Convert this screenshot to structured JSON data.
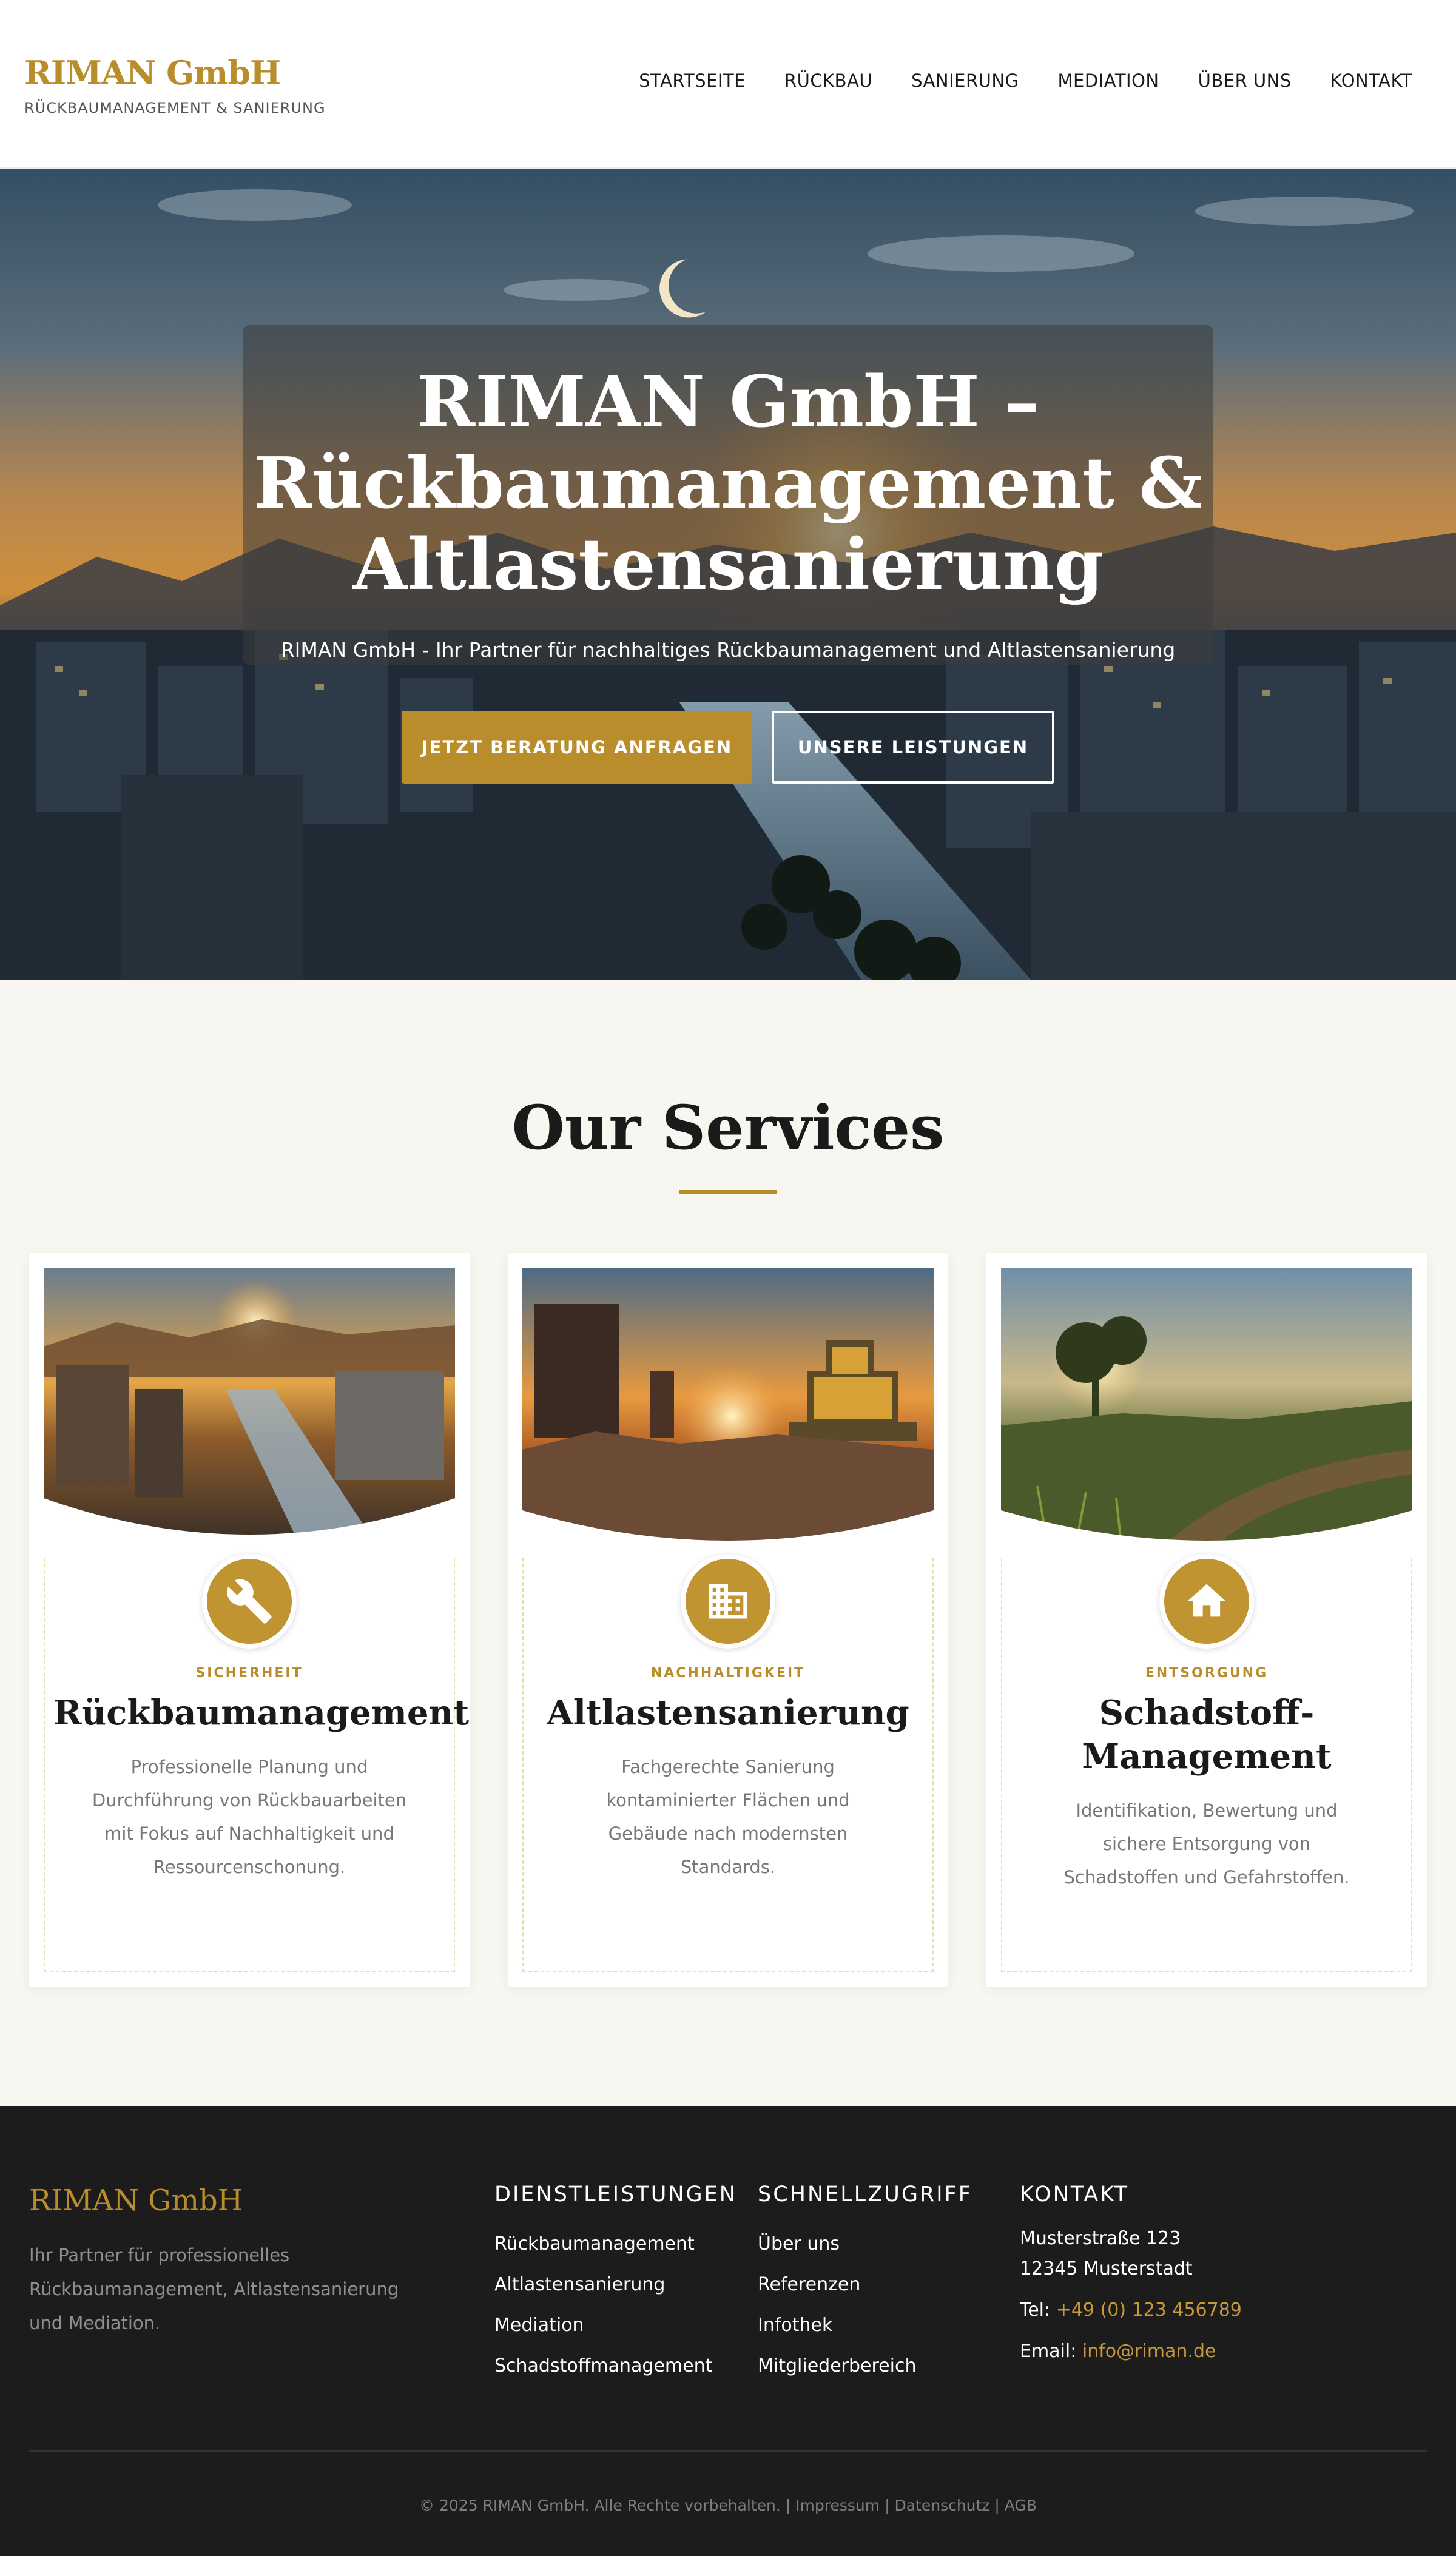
{
  "brand": {
    "name": "RIMAN GmbH",
    "tagline": "RÜCKBAUMANAGEMENT & SANIERUNG",
    "accent_color": "#b98d2c"
  },
  "nav": {
    "items": [
      "STARTSEITE",
      "RÜCKBAU",
      "SANIERUNG",
      "MEDIATION",
      "ÜBER UNS",
      "KONTAKT"
    ]
  },
  "hero": {
    "title": "RIMAN GmbH – Rückbaumanagement & Altlastensanierung",
    "subtitle": "RIMAN GmbH - Ihr Partner für nachhaltiges Rückbaumanagement und Altlastensanierung",
    "primary_button": "JETZT BERATUNG ANFRAGEN",
    "secondary_button": "UNSERE LEISTUNGEN"
  },
  "services": {
    "heading": "Our Services",
    "cards": [
      {
        "tag": "SICHERHEIT",
        "title": "Rückbaumanagement",
        "description": "Professionelle Planung und Durchführung von Rückbauarbeiten mit Fokus auf Nachhaltigkeit und Ressourcenschonung.",
        "icon": "wrench-icon"
      },
      {
        "tag": "NACHHALTIGKEIT",
        "title": "Altlastensanierung",
        "description": "Fachgerechte Sanierung kontaminierter Flächen und Gebäude nach modernsten Standards.",
        "icon": "building-icon"
      },
      {
        "tag": "ENTSORGUNG",
        "title": "Schadstoff-Management",
        "description": "Identifikation, Bewertung und sichere Entsorgung von Schadstoffen und Gefahrstoffen.",
        "icon": "home-icon"
      }
    ]
  },
  "footer": {
    "brand": "RIMAN GmbH",
    "about": "Ihr Partner für professionelles Rückbaumanagement, Altlastensanierung und Mediation.",
    "services_title": "DIENSTLEISTUNGEN",
    "services_links": [
      "Rückbaumanagement",
      "Altlastensanierung",
      "Mediation",
      "Schadstoffmanagement"
    ],
    "quick_title": "SCHNELLZUGRIFF",
    "quick_links": [
      "Über uns",
      "Referenzen",
      "Infothek",
      "Mitgliederbereich"
    ],
    "contact_title": "KONTAKT",
    "address_line1": "Musterstraße 123",
    "address_line2": "12345 Musterstadt",
    "phone_label": "Tel:",
    "phone": "+49 (0) 123 456789",
    "email_label": "Email:",
    "email": "info@riman.de",
    "copyright": "© 2025 RIMAN GmbH. Alle Rechte vorbehalten.",
    "legal_links": [
      "Impressum",
      "Datenschutz",
      "AGB"
    ]
  }
}
